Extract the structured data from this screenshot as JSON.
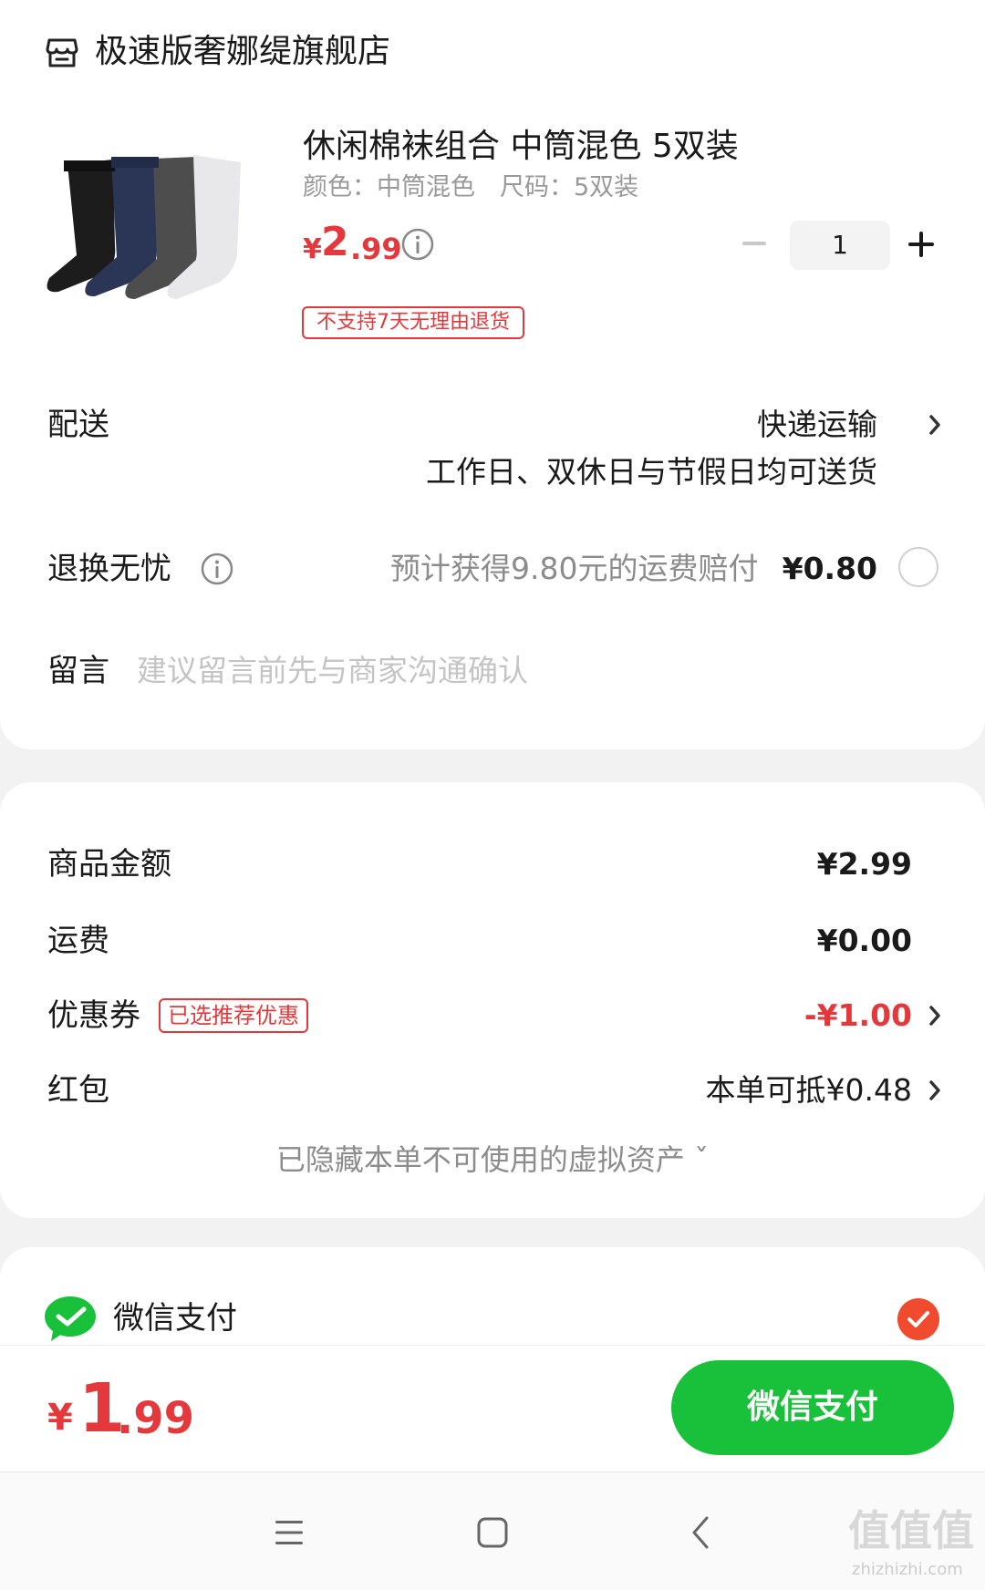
{
  "store": {
    "name": "极速版奢娜缇旗舰店",
    "icon": "store-icon"
  },
  "product": {
    "title": "休闲棉袜组合 中筒混色 5双装",
    "spec": "颜色：中筒混色　尺码：5双装",
    "price_symbol": "¥",
    "price_int": "2",
    "price_dec": ".99",
    "quantity": "1",
    "return_policy": "不支持7天无理由退货"
  },
  "delivery": {
    "label": "配送",
    "method": "快递运输",
    "note": "工作日、双休日与节假日均可送货"
  },
  "return_worry_free": {
    "label": "退换无忧",
    "desc": "预计获得9.80元的运费赔付",
    "price": "¥0.80"
  },
  "message": {
    "label": "留言",
    "placeholder": "建议留言前先与商家沟通确认"
  },
  "summary": {
    "goods_label": "商品金额",
    "goods_value": "¥2.99",
    "shipping_label": "运费",
    "shipping_value": "¥0.00",
    "coupon_label": "优惠券",
    "coupon_badge": "已选推荐优惠",
    "coupon_value": "-¥1.00",
    "redpacket_label": "红包",
    "redpacket_value": "本单可抵¥0.48",
    "hidden_assets": "已隐藏本单不可使用的虚拟资产 ˇ"
  },
  "payment": {
    "method_label": "微信支付",
    "selected": true
  },
  "footer": {
    "total_symbol": "¥",
    "total_int": "1",
    "total_dec": ".99",
    "pay_button": "微信支付"
  },
  "watermark": {
    "glyphs": "值值值",
    "url": "zhizhizhi.com"
  },
  "colors": {
    "accent_red": "#e4393c",
    "wechat_green": "#19c13b",
    "check_orange": "#f04b2f"
  }
}
